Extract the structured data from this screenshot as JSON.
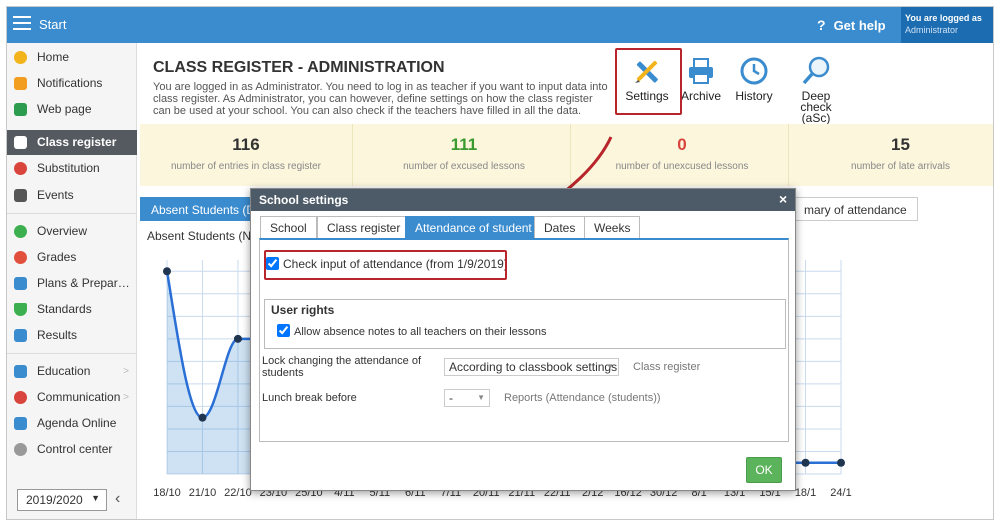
{
  "header": {
    "app_title": "Start",
    "help": "Get help",
    "logged_line1": "You are logged as",
    "logged_line2": "Administrator"
  },
  "sidebar": {
    "items": [
      {
        "label": "Home",
        "icon": "star-icon",
        "color": "#f3b31b"
      },
      {
        "label": "Notifications",
        "icon": "envelope-icon",
        "color": "#f29d20"
      },
      {
        "label": "Web page",
        "icon": "house-icon",
        "color": "#2e9c4f"
      },
      {
        "label": "Class register",
        "icon": "register-icon",
        "color": "#ffffff"
      },
      {
        "label": "Substitution",
        "icon": "person-icon",
        "color": "#d9443d"
      },
      {
        "label": "Events",
        "icon": "calendar-icon",
        "color": "#555555"
      },
      {
        "label": "Overview",
        "icon": "check-circle-icon",
        "color": "#3cb050"
      },
      {
        "label": "Grades",
        "icon": "grades-icon",
        "color": "#e0503d"
      },
      {
        "label": "Plans & Prepar…",
        "icon": "briefcase-icon",
        "color": "#3a8ccf"
      },
      {
        "label": "Standards",
        "icon": "shield-icon",
        "color": "#3cb050"
      },
      {
        "label": "Results",
        "icon": "bar-chart-icon",
        "color": "#3a8ccf"
      },
      {
        "label": "Education",
        "icon": "book-icon",
        "color": "#3a8ccf"
      },
      {
        "label": "Communication",
        "icon": "chat-icon",
        "color": "#d9443d"
      },
      {
        "label": "Agenda Online",
        "icon": "pencil-icon",
        "color": "#3a8ccf"
      },
      {
        "label": "Control center",
        "icon": "gear-icon",
        "color": "#999999"
      }
    ],
    "year": "2019/2020",
    "collapse_glyph": "‹"
  },
  "page": {
    "title": "CLASS REGISTER - ADMINISTRATION",
    "description": "You are logged in as Administrator. You need to log in as teacher if you want to input data into class register. As Administrator, you can however, define settings on how the class register can be used at your school. You can also check if the teachers have filled in all the data."
  },
  "toolbar": {
    "settings": "Settings",
    "archive": "Archive",
    "history": "History",
    "deep_check_1": "Deep check",
    "deep_check_2": "(aSc)"
  },
  "stats": [
    {
      "value": "116",
      "label": "number of entries in class register",
      "color": "#333333"
    },
    {
      "value": "111",
      "label": "number of excused lessons",
      "color": "#3a9a2f"
    },
    {
      "value": "0",
      "label": "number of unexcused lessons",
      "color": "#d9443d"
    },
    {
      "value": "15",
      "label": "number of late arrivals",
      "color": "#333333"
    }
  ],
  "page_tabs": {
    "absent": "Absent Students (Da",
    "summary": "mary of attendance"
  },
  "chart_data": {
    "type": "line",
    "title": "Absent Students (Nu",
    "x": [
      "18/10",
      "21/10",
      "22/10",
      "23/10",
      "25/10",
      "4/11",
      "5/11",
      "6/11",
      "7/11",
      "20/11",
      "21/11",
      "22/11",
      "2/12",
      "16/12",
      "30/12",
      "8/1",
      "13/1",
      "15/1",
      "18/1",
      "24/1"
    ],
    "visible_points": [
      {
        "x": "18/10",
        "y": 9
      },
      {
        "x": "21/10",
        "y": 2.5
      },
      {
        "x": "22/10",
        "y": 6
      },
      {
        "x": "18/1",
        "y": 0.5
      },
      {
        "x": "24/1",
        "y": 0.5
      }
    ],
    "ylim": [
      0,
      9.5
    ],
    "grid": true
  },
  "modal": {
    "title": "School settings",
    "close": "×",
    "tabs": [
      "School",
      "Class register",
      "Attendance of student",
      "Dates",
      "Weeks"
    ],
    "check_attendance": "Check input of attendance (from 1/9/2019)",
    "user_rights_title": "User rights",
    "allow_notes": "Allow absence notes to all teachers on their lessons",
    "lock_label": "Lock changing the attendance of students",
    "lock_value": "According to classbook settings",
    "lock_hint": "Class register",
    "lunch_label": "Lunch break before",
    "lunch_value": "-",
    "lunch_hint": "Reports (Attendance (students))",
    "ok": "OK"
  }
}
